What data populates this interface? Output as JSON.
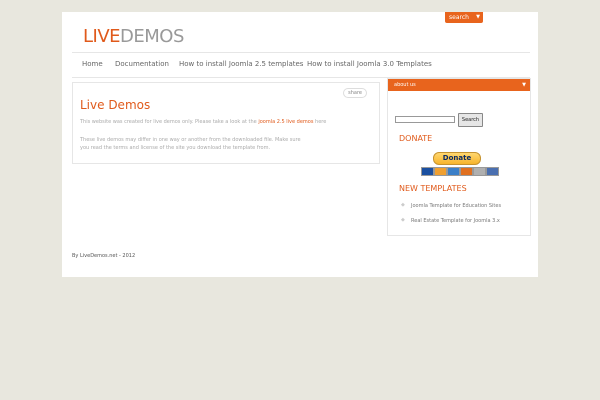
{
  "header": {
    "logo_part1": "LIVE",
    "logo_part2": "DEMOS",
    "search_tab": "search"
  },
  "nav": {
    "items": [
      {
        "label": "Home"
      },
      {
        "label": "Documentation"
      },
      {
        "label": "How to install Joomla 2.5 templates"
      },
      {
        "label": "How to install Joomla 3.0 Templates"
      }
    ]
  },
  "article": {
    "share_label": "share",
    "title": "Live Demos",
    "p1_before": "This website was created for live demos only. Please take a look at the ",
    "p1_link": "joomla 2.5 live demos",
    "p1_after": " here",
    "p2": "These live demos may differ in one way or another from the downloaded file. Make sure you read the terms and license of the site you download the template from."
  },
  "sidebar": {
    "about_label": "about us",
    "search_button": "Search",
    "donate_heading": "DONATE",
    "donate_button": "Donate",
    "new_templates_heading": "NEW TEMPLATES",
    "new_templates": [
      {
        "label": "Joomla Template for Education Sites"
      },
      {
        "label": "Real Estate Template for Joomla 3.x"
      }
    ]
  },
  "footer": {
    "text": "By LiveDemos.net - 2012"
  },
  "colors": {
    "accent": "#e8641d",
    "background": "#e8e7de",
    "heading": "#e05a1b"
  }
}
